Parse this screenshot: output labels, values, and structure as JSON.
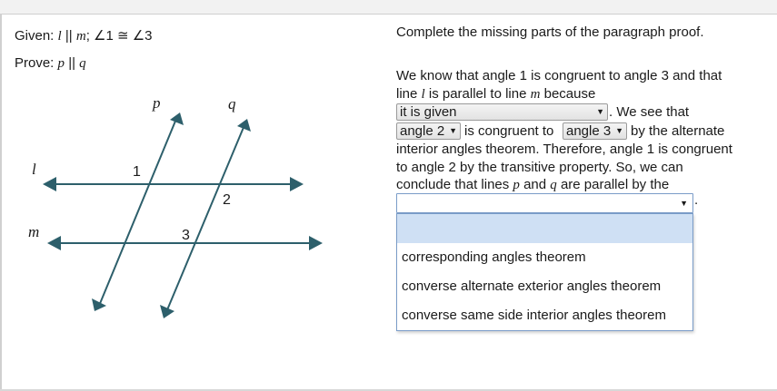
{
  "given": {
    "label": "Given:",
    "line_l": "l",
    "parallel": "||",
    "line_m": "m",
    "rest": "; ∠1 ≅ ∠3"
  },
  "prove": {
    "label": "Prove:",
    "line_p": "p",
    "parallel": "||",
    "line_q": "q"
  },
  "figure": {
    "labels": {
      "p": "p",
      "q": "q",
      "l": "l",
      "m": "m",
      "a1": "1",
      "a2": "2",
      "a3": "3"
    },
    "colors": {
      "lines": "#2d5f6b"
    }
  },
  "instruction": "Complete the missing parts of the paragraph proof.",
  "proof": {
    "line1": "We know that angle 1 is congruent to angle 3 and that",
    "line2_a": "line ",
    "line2_l": "l",
    "line2_b": " is parallel to line ",
    "line2_m": "m",
    "line2_c": " because",
    "dropdown1_value": "it is given",
    "after_dropdown1": ". We see that",
    "dropdown2_value": "angle 2",
    "between_dropdowns": "is congruent to",
    "dropdown3_value": "angle 3",
    "after_dropdown3": "by the alternate",
    "line5": "interior angles theorem. Therefore, angle 1 is congruent",
    "line6": "to angle 2 by the transitive property. So, we can",
    "line7_a": "conclude that lines ",
    "line7_p": "p",
    "line7_and": " and ",
    "line7_q": "q",
    "line7_b": " are parallel by the",
    "end_period": ".",
    "dropdown4_value": "",
    "dropdown4_options": [
      "",
      "corresponding angles theorem",
      "converse alternate exterior angles theorem",
      "converse same side interior angles theorem"
    ]
  },
  "colors": {
    "dropdown_highlight": "#cfe0f4",
    "dropdown_border": "#7a9cc8"
  }
}
